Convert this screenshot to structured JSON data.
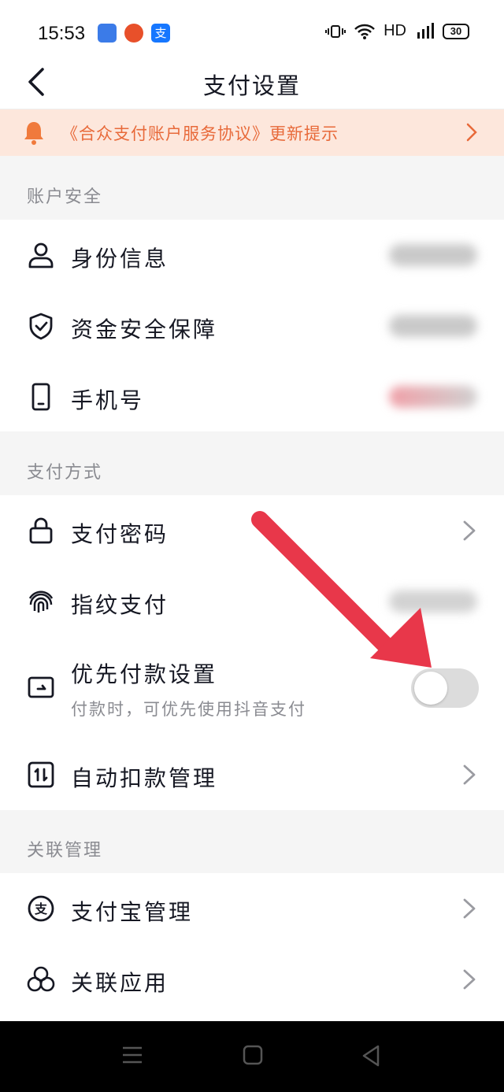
{
  "status_bar": {
    "time": "15:53",
    "network": "HD",
    "battery": "30"
  },
  "nav": {
    "title": "支付设置"
  },
  "notice": {
    "text": "《合众支付账户服务协议》更新提示"
  },
  "sections": {
    "account_security": {
      "title": "账户安全",
      "items": [
        {
          "label": "身份信息",
          "icon": "person-icon"
        },
        {
          "label": "资金安全保障",
          "icon": "shield-check-icon"
        },
        {
          "label": "手机号",
          "icon": "phone-icon"
        }
      ]
    },
    "payment_methods": {
      "title": "支付方式",
      "items": [
        {
          "label": "支付密码",
          "icon": "lock-icon"
        },
        {
          "label": "指纹支付",
          "icon": "fingerprint-icon"
        },
        {
          "label": "优先付款设置",
          "sub": "付款时，可优先使用抖音支付",
          "icon": "wallet-icon",
          "toggle_on": false
        },
        {
          "label": "自动扣款管理",
          "icon": "auto-debit-icon"
        }
      ]
    },
    "linked": {
      "title": "关联管理",
      "items": [
        {
          "label": "支付宝管理",
          "icon": "alipay-icon"
        },
        {
          "label": "关联应用",
          "icon": "linked-apps-icon"
        }
      ]
    }
  },
  "colors": {
    "notice_bg": "#fde7dc",
    "notice_text": "#e86a3a",
    "arrow": "#e8374a",
    "toggle_off": "#dcdcdc"
  }
}
